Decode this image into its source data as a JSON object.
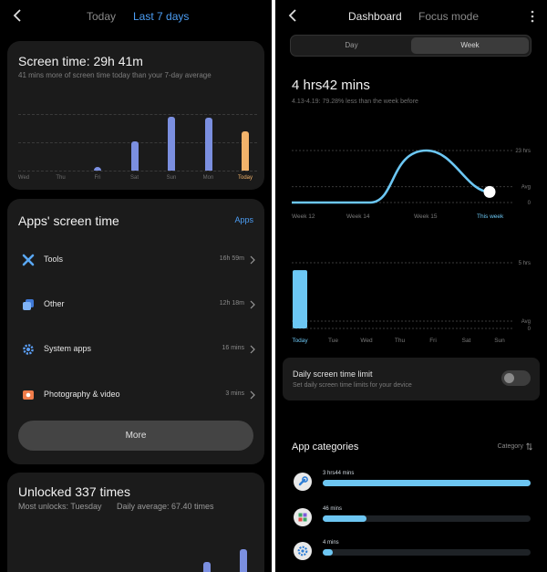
{
  "left": {
    "tabs": {
      "today": "Today",
      "last7": "Last 7 days"
    },
    "screen_time": {
      "title": "Screen time: 29h 41m",
      "subtitle": "41 mins more of screen time today than your 7-day average"
    },
    "apps": {
      "title": "Apps' screen time",
      "link": "Apps",
      "items": [
        {
          "label": "Tools",
          "value": "16h 59m",
          "icon": "tools-icon"
        },
        {
          "label": "Other",
          "value": "12h 18m",
          "icon": "other-apps-icon"
        },
        {
          "label": "System apps",
          "value": "16 mins",
          "icon": "gear-icon"
        },
        {
          "label": "Photography & video",
          "value": "3 mins",
          "icon": "photo-icon"
        }
      ],
      "more_label": "More"
    },
    "unlocked": {
      "title": "Unlocked 337 times",
      "most": "Most unlocks: Tuesday",
      "avg": "Daily average: 67.40 times"
    }
  },
  "right": {
    "tabs": {
      "dashboard": "Dashboard",
      "focus": "Focus mode"
    },
    "segment": {
      "day": "Day",
      "week": "Week"
    },
    "summary": {
      "value": "4 hrs42 mins",
      "sub": "4.13-4.19: 79.28% less than the week before"
    },
    "limit": {
      "title": "Daily screen time limit",
      "sub": "Set daily screen time limits for your device",
      "enabled": false
    },
    "categories": {
      "title": "App categories",
      "sort_label": "Category",
      "items": [
        {
          "value": "3 hrs44 mins",
          "fraction": 1.0,
          "icon": "wrench-icon",
          "icon_color": "#2f7fd6"
        },
        {
          "value": "46 mins",
          "fraction": 0.21,
          "icon": "grid-icon",
          "icon_color": "#3aa563"
        },
        {
          "value": "4 mins",
          "fraction": 0.05,
          "icon": "gear-icon",
          "icon_color": "#2f7fd6"
        }
      ]
    }
  },
  "chart_data": [
    {
      "type": "bar",
      "categories": [
        "Wed",
        "Thu",
        "Fri",
        "Sat",
        "Sun",
        "Mon",
        "Today"
      ],
      "values": [
        0,
        0,
        0.6,
        5.4,
        9.8,
        9.7,
        7.2
      ],
      "colors": [
        "#7b8fe0",
        "#7b8fe0",
        "#7b8fe0",
        "#7b8fe0",
        "#7b8fe0",
        "#7b8fe0",
        "#f2b36b"
      ],
      "ylim": [
        0,
        10
      ]
    },
    {
      "type": "line",
      "x": [
        "Week 12",
        "Week 14",
        "Week 15",
        "This week"
      ],
      "y": [
        0,
        0,
        23,
        4.7
      ],
      "y_ticks": [
        "23 hrs",
        "Avg",
        "0"
      ],
      "avg": 7,
      "ylim": [
        0,
        23
      ],
      "color": "#6cc7f4"
    },
    {
      "type": "bar",
      "categories": [
        "Today",
        "Tue",
        "Wed",
        "Thu",
        "Fri",
        "Sat",
        "Sun"
      ],
      "values": [
        4.7,
        0,
        0,
        0,
        0,
        0,
        0
      ],
      "y_ticks": [
        "5 hrs",
        "Avg",
        "0"
      ],
      "ylim": [
        0,
        5
      ],
      "color": "#6cc7f4"
    },
    {
      "type": "bar",
      "values": [
        0.5,
        0.8,
        1.0,
        1.6,
        2.3,
        3.6
      ],
      "colors": [
        "#7b8fe0",
        "#7b8fe0",
        "#7b8fe0",
        "#7b8fe0",
        "#7b8fe0",
        "#f2b36b"
      ],
      "ylim": [
        0,
        4
      ]
    }
  ]
}
